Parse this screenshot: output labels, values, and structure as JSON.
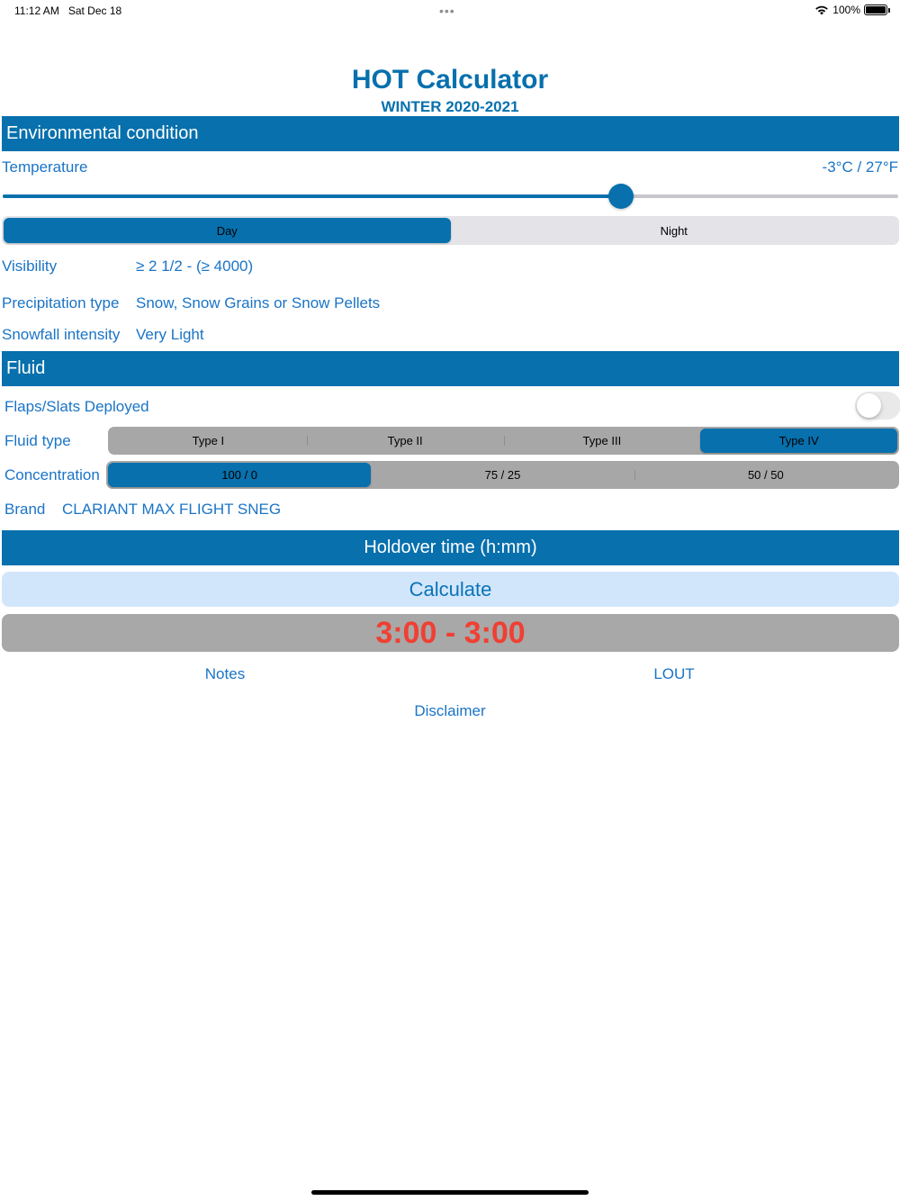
{
  "status_bar": {
    "time": "11:12 AM",
    "date": "Sat Dec 18",
    "dots": "•••",
    "battery": "100%"
  },
  "header": {
    "title": "HOT Calculator",
    "subtitle": "WINTER 2020-2021"
  },
  "environment": {
    "section_title": "Environmental condition",
    "temperature_label": "Temperature",
    "temperature_value": "-3°C / 27°F",
    "temperature_slider_fraction": 0.69,
    "time_of_day": {
      "options": [
        "Day",
        "Night"
      ],
      "selected": "Day"
    },
    "visibility_label": "Visibility",
    "visibility_value": "≥ 2 1/2 - (≥ 4000)",
    "precipitation_label": "Precipitation type",
    "precipitation_value": "Snow, Snow Grains or Snow Pellets",
    "intensity_label": "Snowfall intensity",
    "intensity_value": "Very Light"
  },
  "fluid": {
    "section_title": "Fluid",
    "flaps_label": "Flaps/Slats Deployed",
    "flaps_on": false,
    "type_label": "Fluid type",
    "types": [
      "Type I",
      "Type II",
      "Type III",
      "Type IV"
    ],
    "selected_type": "Type IV",
    "concentration_label": "Concentration",
    "concentrations": [
      "100 / 0",
      "75 / 25",
      "50 / 50"
    ],
    "selected_concentration": "100 / 0",
    "brand_label": "Brand",
    "brand_value": "CLARIANT MAX FLIGHT SNEG"
  },
  "holdover": {
    "section_title": "Holdover time (h:mm)",
    "calculate_label": "Calculate",
    "result": "3:00 - 3:00"
  },
  "links": {
    "notes": "Notes",
    "lout": "LOUT",
    "disclaimer": "Disclaimer"
  },
  "colors": {
    "brand": "#0770ad",
    "link": "#1a74c6",
    "result": "#f13f33",
    "calc_bg": "#d2e6fb"
  }
}
